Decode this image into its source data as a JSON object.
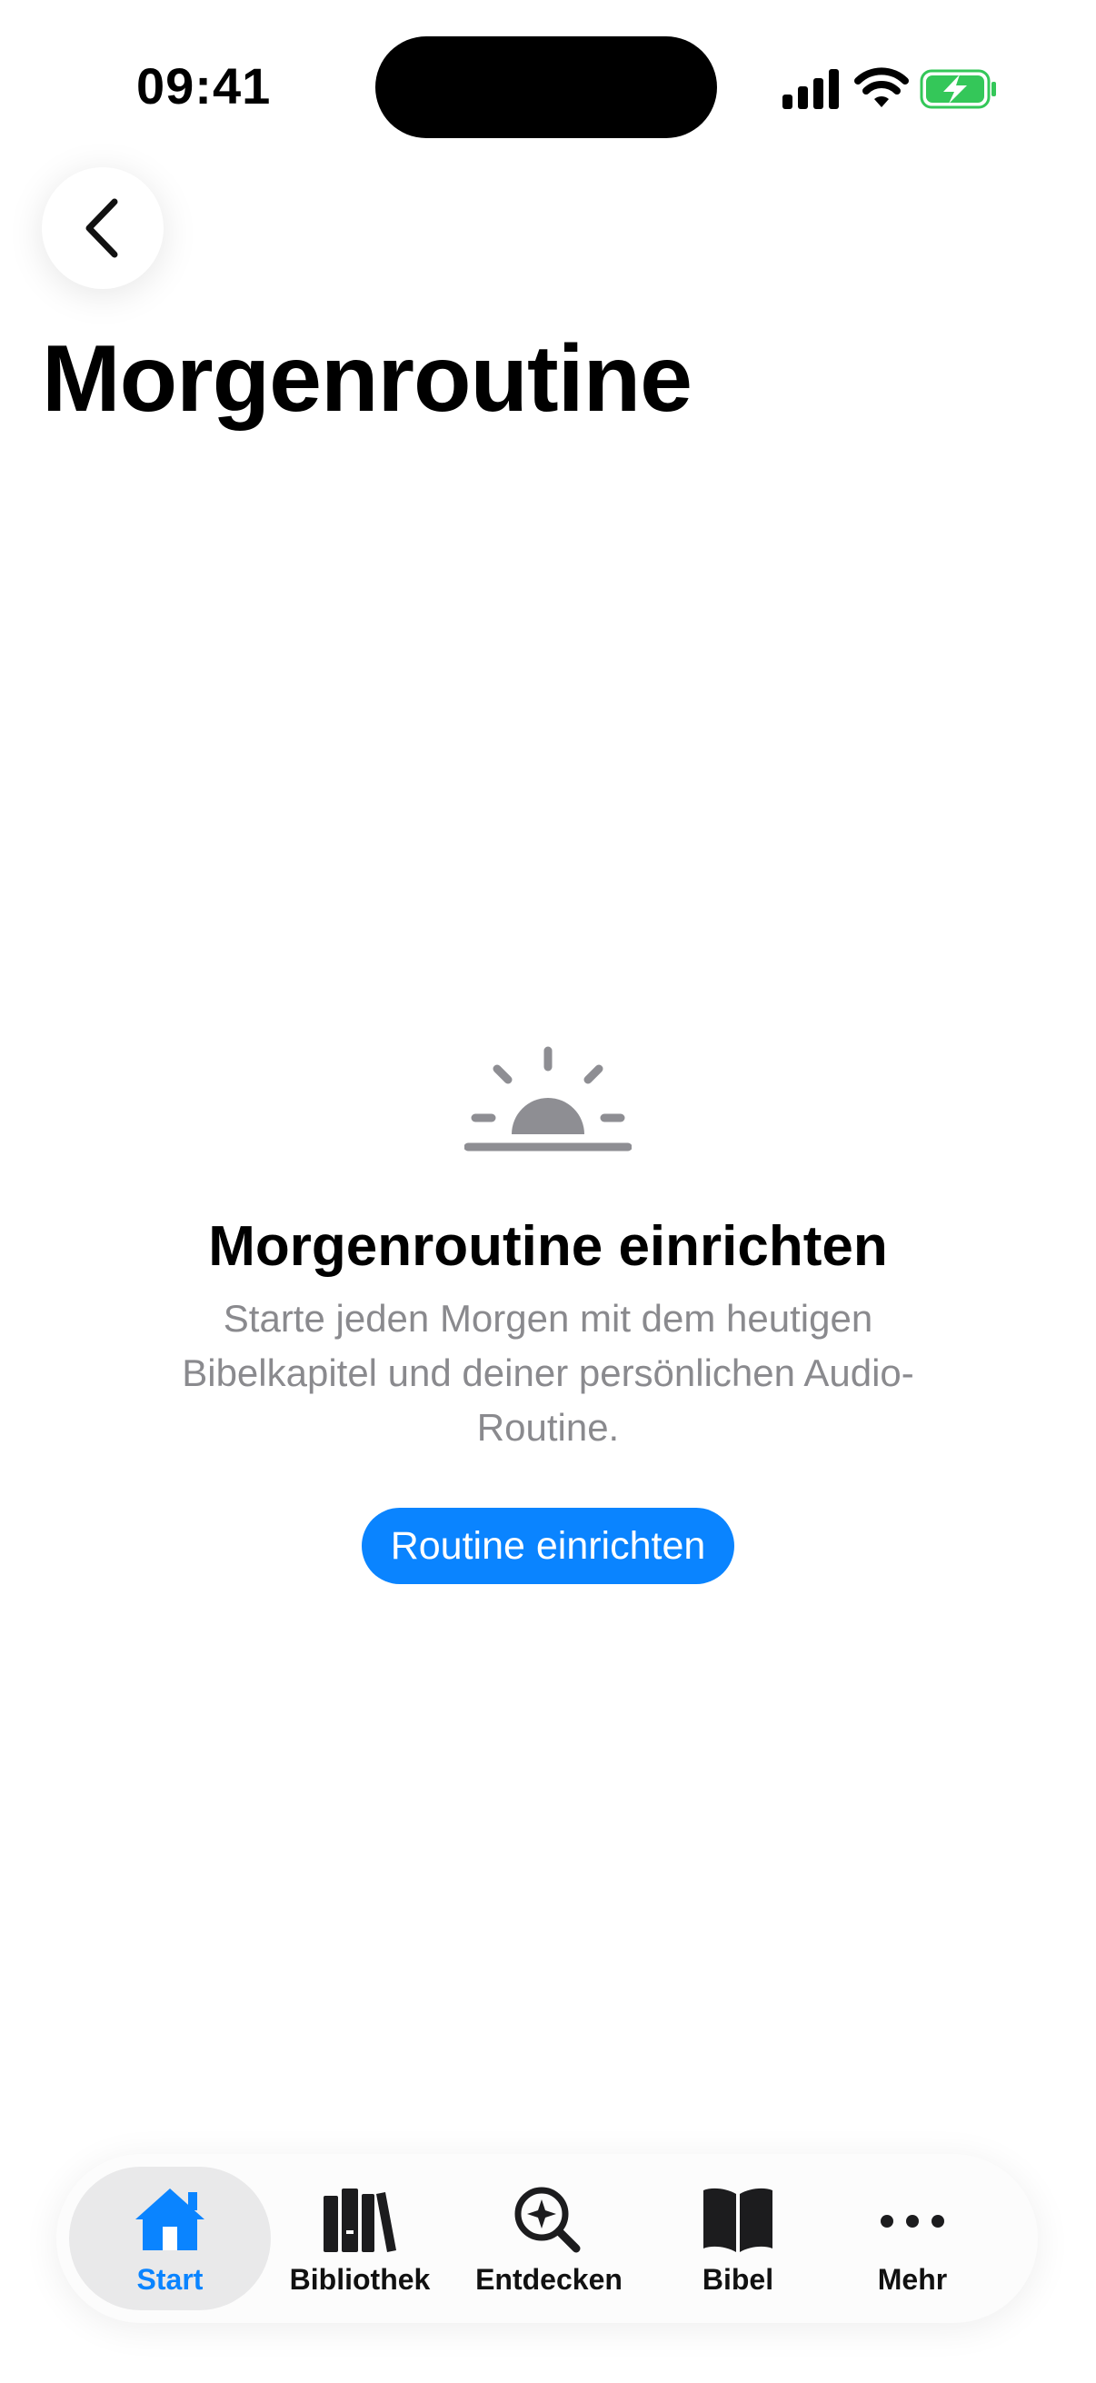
{
  "status": {
    "time": "09:41"
  },
  "header": {
    "title": "Morgenroutine"
  },
  "empty_state": {
    "title": "Morgenroutine einrichten",
    "description": "Starte jeden Morgen mit dem heutigen Bibelkapitel und deiner persönlichen Audio-Routine.",
    "button_label": "Routine einrichten"
  },
  "tabs": [
    {
      "label": "Start",
      "icon": "home-icon",
      "active": true
    },
    {
      "label": "Bibliothek",
      "icon": "books-icon",
      "active": false
    },
    {
      "label": "Entdecken",
      "icon": "discover-icon",
      "active": false
    },
    {
      "label": "Bibel",
      "icon": "book-icon",
      "active": false
    },
    {
      "label": "Mehr",
      "icon": "more-icon",
      "active": false
    }
  ],
  "colors": {
    "accent": "#0a84ff",
    "secondary_text": "#8a8a8e",
    "icon_gray": "#8e8e93",
    "battery_green": "#34c759"
  }
}
